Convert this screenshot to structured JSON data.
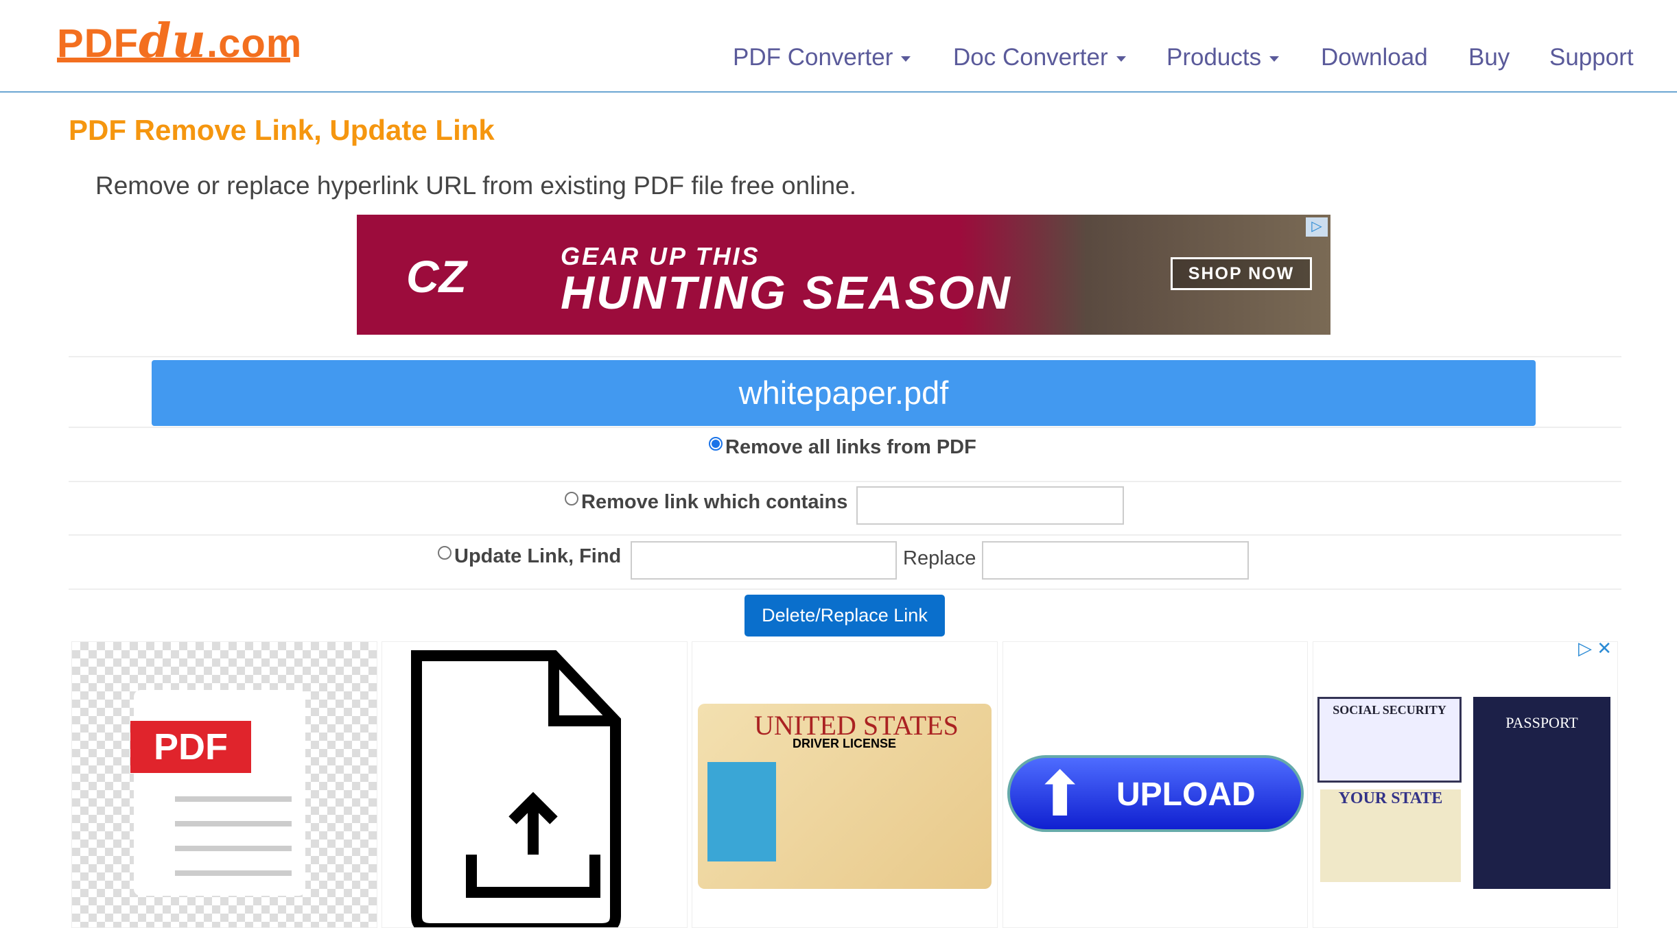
{
  "header": {
    "logo": {
      "prefix": "PDF",
      "script": "du",
      "suffix": ".com"
    },
    "nav": [
      {
        "label": "PDF Converter",
        "dropdown": true
      },
      {
        "label": "Doc Converter",
        "dropdown": true
      },
      {
        "label": "Products",
        "dropdown": true
      },
      {
        "label": "Download",
        "dropdown": false
      },
      {
        "label": "Buy",
        "dropdown": false
      },
      {
        "label": "Support",
        "dropdown": false
      }
    ]
  },
  "page": {
    "title": "PDF Remove Link, Update Link",
    "subtitle": "Remove or replace hyperlink URL from existing PDF file free online."
  },
  "ad_banner": {
    "brand": "CZ",
    "line1": "GEAR UP THIS",
    "line2": "HUNTING SEASON",
    "cta": "SHOP NOW"
  },
  "form": {
    "file_name": "whitepaper.pdf",
    "option_remove_all": {
      "label": "Remove all links from PDF",
      "selected": true
    },
    "option_remove_contains": {
      "label": "Remove link which contains",
      "selected": false,
      "value": ""
    },
    "option_update": {
      "label": "Update Link, Find",
      "selected": false,
      "find_value": "",
      "replace_label": "Replace",
      "replace_value": ""
    },
    "submit_label": "Delete/Replace Link"
  },
  "ad_tiles": [
    {
      "text": "PDF"
    },
    {
      "text": ""
    },
    {
      "text": "UNITED STATES",
      "sub": "DRIVER LICENSE"
    },
    {
      "text": "UPLOAD"
    },
    {
      "text": "SOCIAL SECURITY",
      "sub": "PASSPORT",
      "sub2": "YOUR STATE"
    }
  ],
  "colors": {
    "accent": "#4299f0",
    "button": "#0a6fcc",
    "title": "#f5960f",
    "logo": "#f36f1f",
    "nav": "#5a5a9a"
  }
}
